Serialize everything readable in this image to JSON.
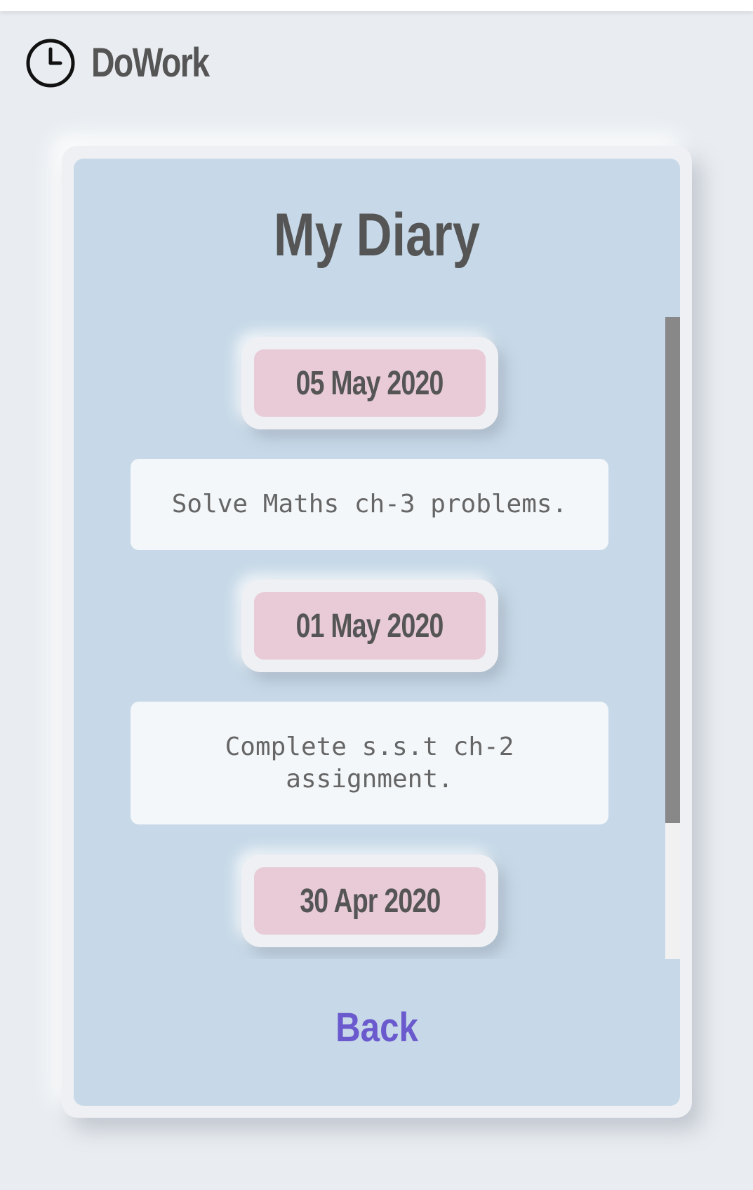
{
  "app": {
    "name": "DoWork",
    "icon": "clock-icon"
  },
  "diary": {
    "title": "My Diary",
    "entries": [
      {
        "date": "05 May 2020",
        "note": "Solve Maths ch-3 problems."
      },
      {
        "date": "01 May 2020",
        "note": "Complete s.s.t ch-2 assignment."
      },
      {
        "date": "30 Apr 2020",
        "note": ""
      }
    ]
  },
  "actions": {
    "back_label": "Back"
  },
  "colors": {
    "background": "#e9edf1",
    "card": "#c7d9e8",
    "date_pill": "#e8cbd6",
    "note_box": "#f3f7fa",
    "text": "#555555",
    "link": "#6a5acd",
    "scrollbar_thumb": "#888888"
  }
}
